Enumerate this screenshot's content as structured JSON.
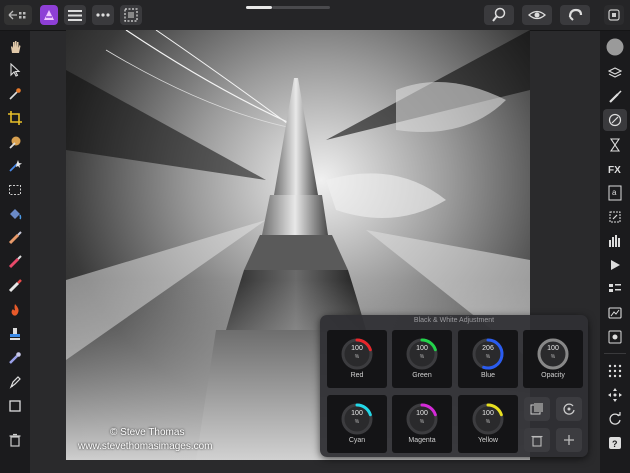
{
  "panel": {
    "title": "Black & White Adjustment",
    "dials": [
      {
        "label": "Red",
        "value": "100",
        "unit": "%",
        "color": "#e8262b",
        "level": 0.2
      },
      {
        "label": "Green",
        "value": "100",
        "unit": "%",
        "color": "#22d44a",
        "level": 0.2
      },
      {
        "label": "Blue",
        "value": "206",
        "unit": "%",
        "color": "#2a5cf0",
        "level": 0.55
      },
      {
        "label": "Opacity",
        "value": "100",
        "unit": "%",
        "color": "#888888",
        "level": 1.0
      },
      {
        "label": "Cyan",
        "value": "100",
        "unit": "%",
        "color": "#22d8e8",
        "level": 0.2
      },
      {
        "label": "Magenta",
        "value": "100",
        "unit": "%",
        "color": "#d42ad8",
        "level": 0.2
      },
      {
        "label": "Yellow",
        "value": "100",
        "unit": "%",
        "color": "#e8e020",
        "level": 0.2
      }
    ]
  },
  "watermark": {
    "line1": "© Steve Thomas",
    "line2": "www.stevethomasimages.com"
  },
  "icons": {
    "top": [
      "back-grid-icon",
      "app-logo-icon",
      "menu-icon",
      "more-icon",
      "selection-icon",
      "zoom-icon",
      "view-icon",
      "snapping-icon",
      "persona-icon"
    ],
    "left": [
      "hand-icon",
      "move-icon",
      "color-picker-icon",
      "crop-icon",
      "paint-mixer-icon",
      "selection-brush-icon",
      "marquee-icon",
      "flood-fill-icon",
      "brush-icon",
      "eraser-icon",
      "healing-icon",
      "burn-icon",
      "clone-icon",
      "smudge-icon",
      "pen-icon",
      "shape-icon",
      "trash-icon"
    ],
    "right": [
      "color-icon",
      "layers-icon",
      "brushes-icon",
      "adjustments-icon",
      "history-icon",
      "fx-icon",
      "text-styles-icon",
      "transform-icon",
      "histogram-icon",
      "macro-icon",
      "channels-icon",
      "navigator-icon",
      "settings-icon",
      "grid-icon",
      "move-arrows-icon",
      "refresh-icon",
      "help-icon"
    ]
  }
}
